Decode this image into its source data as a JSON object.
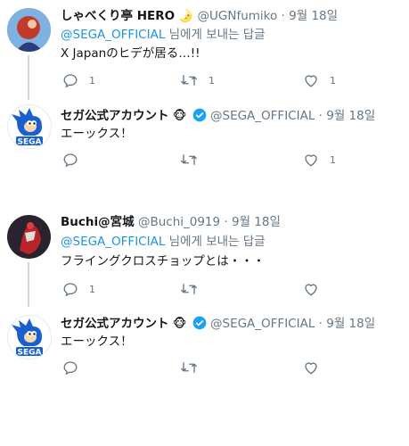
{
  "tweets": [
    {
      "display_name": "しゃべくり亭 HERO",
      "name_emoji": "🌛",
      "handle": "@UGNfumiko",
      "date": "9월 18일",
      "reply_to_mention": "@SEGA_OFFICIAL",
      "reply_to_suffix": "님에게 보내는 답글",
      "text": "X Japanのヒデが居る…!!",
      "replies": "1",
      "retweets": "1",
      "likes": "1"
    },
    {
      "display_name": "セガ公式アカウント",
      "name_emoji": "🐵",
      "handle": "@SEGA_OFFICIAL",
      "date": "9월 18일",
      "text": "エーックス！",
      "replies": "",
      "retweets": "",
      "likes": "1"
    },
    {
      "display_name": "Buchi@宮城",
      "handle": "@Buchi_0919",
      "date": "9월 18일",
      "reply_to_mention": "@SEGA_OFFICIAL",
      "reply_to_suffix": "님에게 보내는 답글",
      "text": "フライングクロスチョップとは・・・",
      "replies": "1",
      "retweets": "",
      "likes": ""
    },
    {
      "display_name": "セガ公式アカウント",
      "name_emoji": "🐵",
      "handle": "@SEGA_OFFICIAL",
      "date": "9월 18일",
      "text": "エーックス！",
      "replies": "",
      "retweets": "",
      "likes": ""
    }
  ],
  "separator": "·",
  "sega_logo_text": "SEGA",
  "colors": {
    "link": "#1b95e0",
    "muted": "#657786",
    "verified": "#1da1f2",
    "thread_line": "#ccd6dd"
  }
}
